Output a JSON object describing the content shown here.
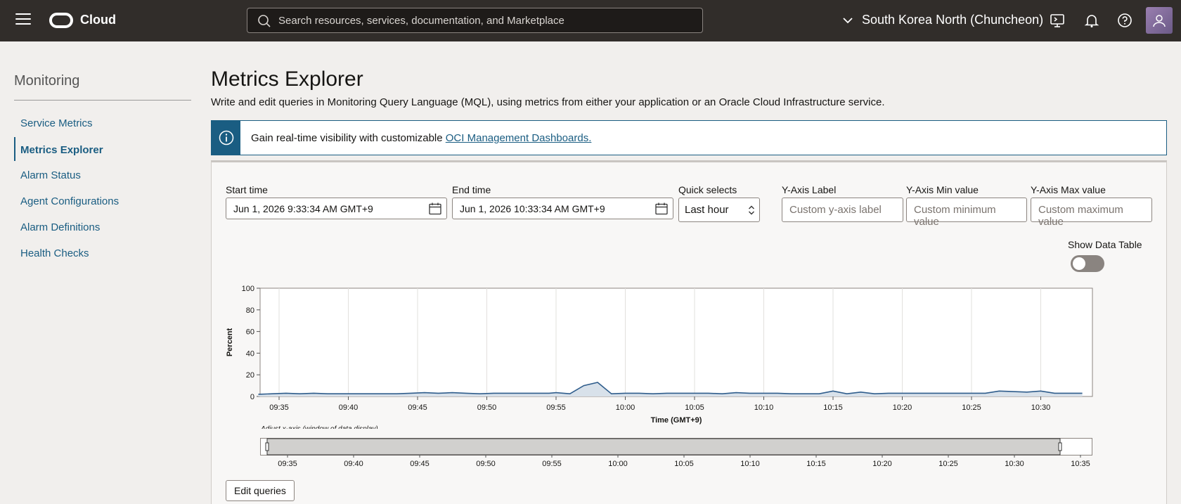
{
  "header": {
    "brand": "Cloud",
    "search_placeholder": "Search resources, services, documentation, and Marketplace",
    "region": "South Korea North (Chuncheon)"
  },
  "sidebar": {
    "title": "Monitoring",
    "items": [
      {
        "label": "Service Metrics"
      },
      {
        "label": "Metrics Explorer"
      },
      {
        "label": "Alarm Status"
      },
      {
        "label": "Agent Configurations"
      },
      {
        "label": "Alarm Definitions"
      },
      {
        "label": "Health Checks"
      }
    ]
  },
  "main": {
    "title": "Metrics Explorer",
    "description": "Write and edit queries in Monitoring Query Language (MQL), using metrics from either your application or an Oracle Cloud Infrastructure service.",
    "banner_text": "Gain real-time visibility with customizable ",
    "banner_link": "OCI Management Dashboards."
  },
  "controls": {
    "start_label": "Start time",
    "start_value": "Jun 1, 2026 9:33:34 AM GMT+9",
    "end_label": "End time",
    "end_value": "Jun 1, 2026 10:33:34 AM GMT+9",
    "quick_label": "Quick selects",
    "quick_value": "Last hour",
    "yaxis_label": "Y-Axis Label",
    "yaxis_placeholder": "Custom y-axis label",
    "ymin_label": "Y-Axis Min value",
    "ymin_placeholder": "Custom minimum value",
    "ymax_label": "Y-Axis Max value",
    "ymax_placeholder": "Custom maximum value",
    "show_table_label": "Show Data Table",
    "show_table_on": false,
    "edit_queries": "Edit queries"
  },
  "colors": {
    "accent": "#1a5d82",
    "topbar": "#312d2a",
    "series": "#2f5d8c"
  },
  "chart_data": {
    "type": "area",
    "ylabel": "Percent",
    "xlabel": "Time (GMT+9)",
    "ylim": [
      0,
      100
    ],
    "yticks": [
      0,
      20,
      40,
      60,
      80,
      100
    ],
    "xticks": [
      "09:35",
      "09:40",
      "09:45",
      "09:50",
      "09:55",
      "10:00",
      "10:05",
      "10:10",
      "10:15",
      "10:20",
      "10:25",
      "10:30"
    ],
    "navigator_label": "Adjust x-axis (window of data display)",
    "navigator_ticks": [
      "09:35",
      "09:40",
      "09:45",
      "09:50",
      "09:55",
      "10:00",
      "10:05",
      "10:10",
      "10:15",
      "10:20",
      "10:25",
      "10:30",
      "10:35"
    ],
    "x_minutes_from_0935": [
      -1.5,
      -0.5,
      0.5,
      1.5,
      2.5,
      3.5,
      4.5,
      5.5,
      6.5,
      7.5,
      8.5,
      9.5,
      10.5,
      11.5,
      12.5,
      13.5,
      14.5,
      15.5,
      16.5,
      17.5,
      18.5,
      19.5,
      20,
      21,
      22,
      23,
      24,
      25,
      26,
      27,
      28,
      29,
      30,
      31,
      32,
      33,
      34,
      35,
      36,
      37,
      38,
      39,
      40,
      41,
      42,
      43,
      44,
      45,
      46,
      47,
      48,
      49,
      50,
      51,
      52,
      53,
      54,
      55,
      56,
      57,
      58
    ],
    "values": [
      2,
      2.5,
      3,
      2.5,
      3,
      2.5,
      2.5,
      2.5,
      2.5,
      2.5,
      2.5,
      3,
      3.5,
      3,
      3.5,
      3,
      2.5,
      3,
      3,
      3,
      3,
      3,
      3.5,
      2.5,
      10,
      13,
      2.5,
      3,
      3,
      2.5,
      3,
      3,
      3,
      3,
      2.5,
      3.5,
      3,
      3,
      3,
      2.5,
      2.5,
      2.5,
      5,
      2.5,
      4,
      2.5,
      3,
      3,
      3,
      3,
      3,
      3,
      3,
      3,
      5,
      4.5,
      4,
      5,
      3,
      3,
      3
    ]
  }
}
